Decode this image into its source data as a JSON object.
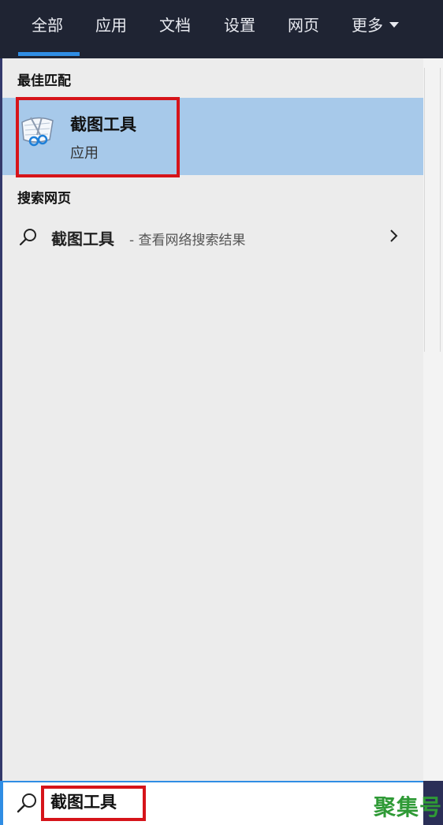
{
  "tabs": [
    {
      "label": "全部",
      "active": true
    },
    {
      "label": "应用"
    },
    {
      "label": "文档"
    },
    {
      "label": "设置"
    },
    {
      "label": "网页"
    },
    {
      "label": "更多"
    }
  ],
  "best_match": {
    "section_title": "最佳匹配",
    "app_name": "截图工具",
    "app_type": "应用",
    "icon": "snipping-tool-icon",
    "highlight_color": "#a7c9ea"
  },
  "web_search": {
    "section_title": "搜索网页",
    "query": "截图工具",
    "description": "- 查看网络搜索结果",
    "icon": "search-icon"
  },
  "search_box": {
    "value": "截图工具",
    "icon": "search-icon"
  },
  "watermark": "聚集号",
  "colors": {
    "accent": "#2f8de4",
    "annotation_red": "#d6141a",
    "tabbar_bg": "#1f2433",
    "panel_bg": "#ececec"
  }
}
